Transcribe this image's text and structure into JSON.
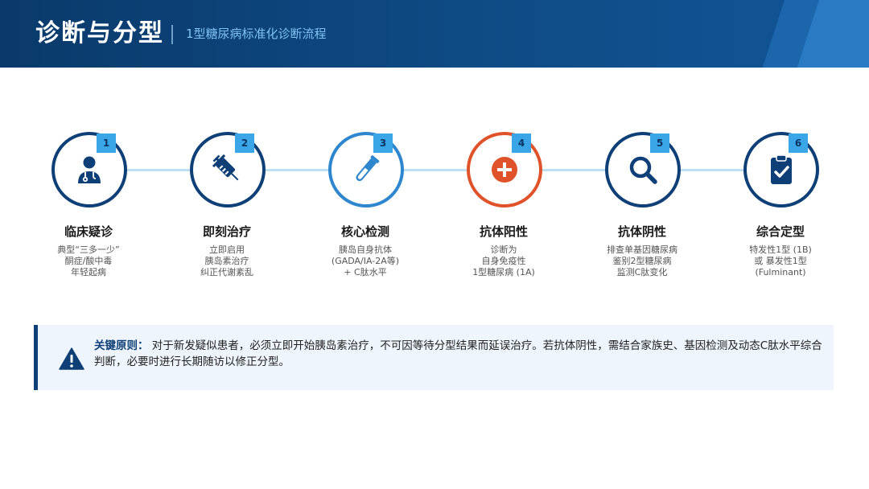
{
  "header": {
    "title": "诊断与分型",
    "subtitle": "1型糖尿病标准化诊断流程"
  },
  "steps": [
    {
      "number": "1",
      "title": "临床疑诊",
      "icon": "doctor-icon",
      "lines": [
        "典型“三多一少”",
        "酮症/酸中毒",
        "年轻起病"
      ]
    },
    {
      "number": "2",
      "title": "即刻治疗",
      "icon": "syringe-icon",
      "lines": [
        "立即启用",
        "胰岛素治疗",
        "纠正代谢紊乱"
      ]
    },
    {
      "number": "3",
      "title": "核心检测",
      "icon": "test-tube-icon",
      "lines": [
        "胰岛自身抗体",
        "(GADA/IA-2A等)",
        "+ C肽水平"
      ]
    },
    {
      "number": "4",
      "title": "抗体阳性",
      "icon": "plus-circle-icon",
      "lines": [
        "诊断为",
        "自身免疫性",
        "1型糖尿病 (1A)"
      ]
    },
    {
      "number": "5",
      "title": "抗体阴性",
      "icon": "search-icon",
      "lines": [
        "排查单基因糖尿病",
        "鉴别2型糖尿病",
        "监测C肽变化"
      ]
    },
    {
      "number": "6",
      "title": "综合定型",
      "icon": "clipboard-check-icon",
      "lines": [
        "特发性1型 (1B)",
        "或 暴发性1型",
        "(Fulminant)"
      ]
    }
  ],
  "note": {
    "icon": "warning-icon",
    "label": "关键原则：",
    "text": "对于新发疑似患者，必须立即开始胰岛素治疗，不可因等待分型结果而延误治疗。若抗体阴性，需结合家族史、基因检测及动态C肽水平综合判断，必要时进行长期随访以修正分型。"
  },
  "colors": {
    "header_bg": "#0f4c87",
    "navy": "#0f3f77",
    "accent_blue": "#2e86cf",
    "accent_red": "#e0522a",
    "badge": "#3aa6e8",
    "connector": "#bfe0f2",
    "note_bg": "#eef5fc"
  }
}
